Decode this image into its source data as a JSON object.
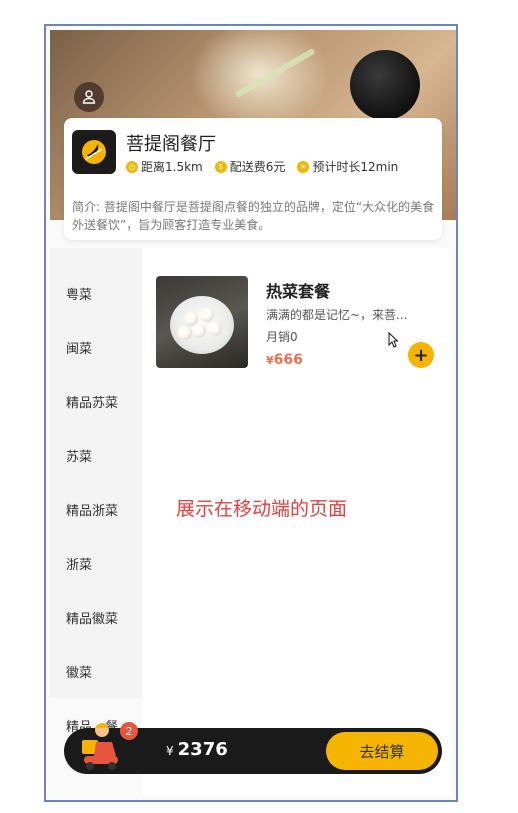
{
  "shop": {
    "name": "菩提阁餐厅",
    "distance": "距离1.5km",
    "delivery_fee": "配送费6元",
    "eta": "预计时长12min",
    "intro": "简介: 菩提阁中餐厅是菩提阁点餐的独立的品牌，定位“大众化的美食外送餐饮”，旨为顾客打造专业美食。"
  },
  "categories": [
    {
      "label": "粤菜"
    },
    {
      "label": "闽菜"
    },
    {
      "label": "精品苏菜"
    },
    {
      "label": "苏菜"
    },
    {
      "label": "精品浙菜"
    },
    {
      "label": "浙菜"
    },
    {
      "label": "精品徽菜"
    },
    {
      "label": "徽菜"
    },
    {
      "label": "精品…餐"
    }
  ],
  "dish": {
    "title": "热菜套餐",
    "desc": "满满的都是记忆~，来菩...",
    "sales": "月销0",
    "currency": "¥",
    "price": "666",
    "add_label": "+"
  },
  "caption": "展示在移动端的页面",
  "cart": {
    "count": "2",
    "currency": "¥",
    "total": "2376",
    "checkout_label": "去结算"
  },
  "icons": {
    "avatar": "user-icon",
    "logo": "shop-logo",
    "distance": "clock-icon",
    "fee": "money-bag-icon",
    "eta": "navigation-icon",
    "cart": "delivery-person-icon",
    "cursor": "mouse-pointer-icon"
  },
  "colors": {
    "accent": "#f5b400",
    "price": "#e8734a",
    "caption": "#e34040",
    "cart_bg": "#1a1a1a"
  }
}
